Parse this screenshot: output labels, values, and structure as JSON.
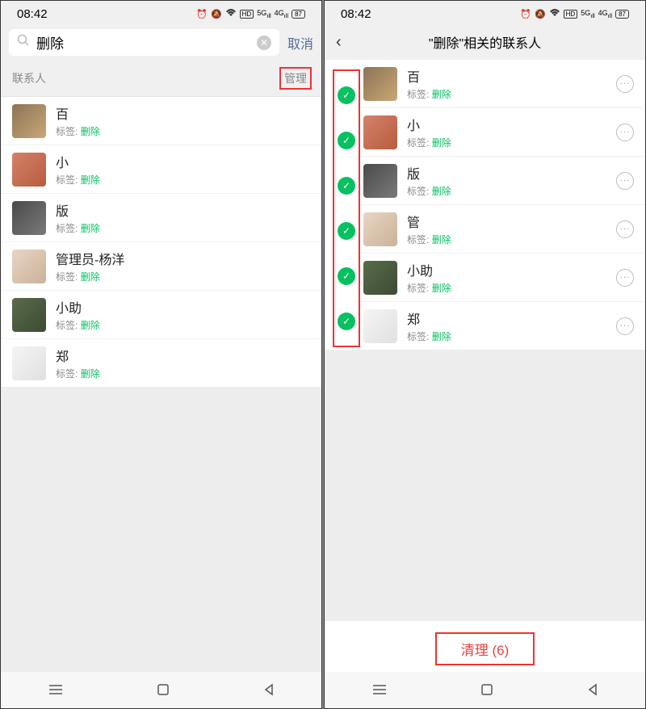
{
  "status": {
    "time": "08:42",
    "battery": "87"
  },
  "left": {
    "search": {
      "value": "删除"
    },
    "cancel": "取消",
    "section_label": "联系人",
    "manage": "管理",
    "tag_label": "标签:",
    "contacts": [
      {
        "name": "百",
        "tag": "删除"
      },
      {
        "name": "小",
        "tag": "删除"
      },
      {
        "name": "版",
        "tag": "删除"
      },
      {
        "name": "管理员-杨洋",
        "tag": "删除"
      },
      {
        "name": "小助",
        "tag": "删除"
      },
      {
        "name": "郑",
        "tag": "删除"
      }
    ]
  },
  "right": {
    "title": "\"删除\"相关的联系人",
    "tag_label": "标签:",
    "contacts": [
      {
        "name": "百",
        "tag": "删除",
        "selected": true
      },
      {
        "name": "小",
        "tag": "删除",
        "selected": true
      },
      {
        "name": "版",
        "tag": "删除",
        "selected": true
      },
      {
        "name": "管",
        "tag": "删除",
        "selected": true
      },
      {
        "name": "小助",
        "tag": "删除",
        "selected": true
      },
      {
        "name": "郑",
        "tag": "删除",
        "selected": true
      }
    ],
    "clean_button": "清理 (6)"
  }
}
